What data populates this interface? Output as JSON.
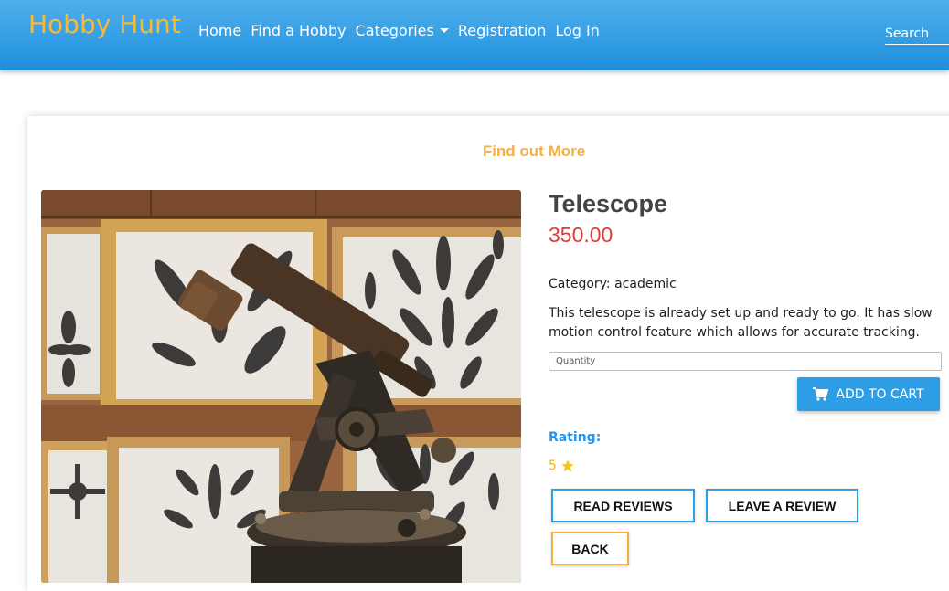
{
  "navbar": {
    "brand": "Hobby Hunt",
    "links": [
      "Home",
      "Find a Hobby",
      "Categories",
      "Registration",
      "Log In"
    ],
    "search_placeholder": "Search"
  },
  "card": {
    "heading": "Find out More"
  },
  "product": {
    "title": "Telescope",
    "price": "350.00",
    "category": "Category: academic",
    "description": "This telescope is already set up and ready to go. It has slow motion control feature which allows for accurate tracking.",
    "quantity_placeholder": "Quantity",
    "add_to_cart": "ADD TO CART",
    "rating_label": "Rating:",
    "rating_value": "5",
    "read_reviews": "READ REVIEWS",
    "leave_review": "LEAVE A REVIEW",
    "back": "BACK"
  },
  "colors": {
    "navbar": "#2d9ee6",
    "brand": "#f7b83c",
    "heading": "#f5b041",
    "price": "#e53935",
    "rating": "#2196f3",
    "star": "#f5b800"
  },
  "icons": [
    "cart-icon",
    "star-icon",
    "caret-down-icon"
  ]
}
